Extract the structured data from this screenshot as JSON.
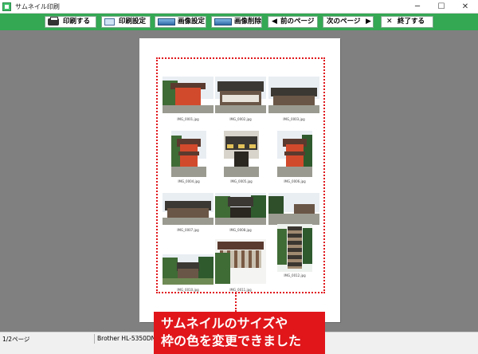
{
  "window": {
    "title": "サムネイル印刷",
    "minimize": "─",
    "maximize": "☐",
    "close": "✕"
  },
  "toolbar": {
    "print": "印刷する",
    "print_settings": "印刷設定",
    "image_settings": "画像設定",
    "image_delete": "画像削除",
    "prev_page": "前のページ",
    "next_page": "次のページ",
    "exit": "終了する",
    "prev_arrow": "◀",
    "next_arrow": "▶",
    "exit_x": "✕",
    "colors": {
      "bar": "#34a853"
    }
  },
  "page": {
    "thumbnails": [
      {
        "caption": "IMG_0001.jpg"
      },
      {
        "caption": "IMG_0002.jpg"
      },
      {
        "caption": "IMG_0003.jpg"
      },
      {
        "caption": "IMG_0004.jpg"
      },
      {
        "caption": "IMG_0005.jpg"
      },
      {
        "caption": "IMG_0006.jpg"
      },
      {
        "caption": "IMG_0007.jpg"
      },
      {
        "caption": "IMG_0008.jpg"
      },
      {
        "caption": "IMG_0009.jpg"
      },
      {
        "caption": "IMG_0010.jpg"
      },
      {
        "caption": "IMG_0011.jpg"
      },
      {
        "caption": "IMG_0012.jpg"
      }
    ],
    "frame_color": "#e0161b"
  },
  "status": {
    "page_indicator": "1/2ページ",
    "printer": "Brother HL-5350DN s"
  },
  "callout": {
    "line1": "サムネイルのサイズや",
    "line2": "枠の色を変更できました"
  }
}
